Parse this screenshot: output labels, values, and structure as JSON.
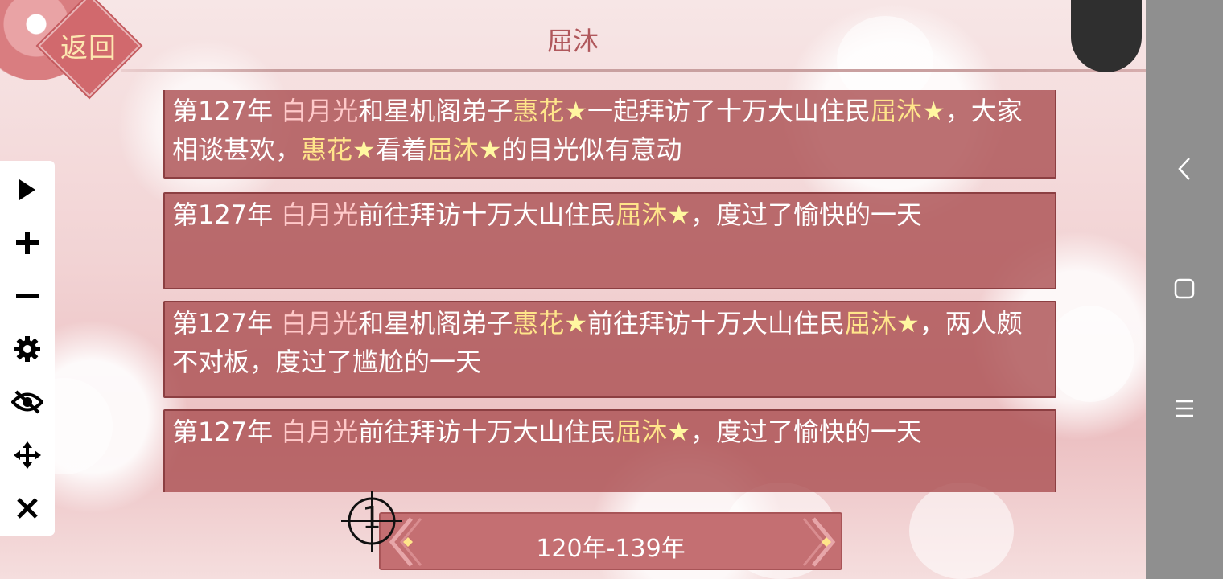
{
  "header": {
    "back_label": "返回",
    "title": "屈沐"
  },
  "toolbar": {
    "items": [
      {
        "name": "play-icon"
      },
      {
        "name": "plus-icon"
      },
      {
        "name": "minus-icon"
      },
      {
        "name": "gear-icon"
      },
      {
        "name": "eye-off-icon"
      },
      {
        "name": "move-icon"
      },
      {
        "name": "close-icon"
      }
    ]
  },
  "log": {
    "entries": [
      {
        "year": "第127年 ",
        "segments": [
          {
            "text": "白月光",
            "style": "a"
          },
          {
            "text": "和星机阁弟子",
            "style": "n"
          },
          {
            "text": "惠花",
            "style": "b"
          },
          {
            "text": "★",
            "style": "s"
          },
          {
            "text": "一起拜访了十万大山住民",
            "style": "n"
          },
          {
            "text": "屈沐",
            "style": "b"
          },
          {
            "text": "★",
            "style": "s"
          },
          {
            "text": "，大家相谈甚欢，",
            "style": "n"
          },
          {
            "text": "惠花",
            "style": "b"
          },
          {
            "text": "★",
            "style": "s"
          },
          {
            "text": "看着",
            "style": "n"
          },
          {
            "text": "屈沐",
            "style": "b"
          },
          {
            "text": "★",
            "style": "s"
          },
          {
            "text": "的目光似有意动",
            "style": "n"
          }
        ]
      },
      {
        "year": "第127年 ",
        "segments": [
          {
            "text": "白月光",
            "style": "a"
          },
          {
            "text": "前往拜访十万大山住民",
            "style": "n"
          },
          {
            "text": "屈沐",
            "style": "b"
          },
          {
            "text": "★",
            "style": "s"
          },
          {
            "text": "，度过了愉快的一天",
            "style": "n"
          }
        ]
      },
      {
        "year": "第127年 ",
        "segments": [
          {
            "text": "白月光",
            "style": "a"
          },
          {
            "text": "和星机阁弟子",
            "style": "n"
          },
          {
            "text": "惠花",
            "style": "b"
          },
          {
            "text": "★",
            "style": "s"
          },
          {
            "text": "前往拜访十万大山住民",
            "style": "n"
          },
          {
            "text": "屈沐",
            "style": "b"
          },
          {
            "text": "★",
            "style": "s"
          },
          {
            "text": "，两人颇不对板，度过了尴尬的一天",
            "style": "n"
          }
        ]
      },
      {
        "year": "第127年 ",
        "segments": [
          {
            "text": "白月光",
            "style": "a"
          },
          {
            "text": "前往拜访十万大山住民",
            "style": "n"
          },
          {
            "text": "屈沐",
            "style": "b"
          },
          {
            "text": "★",
            "style": "s"
          },
          {
            "text": "，度过了愉快的一天",
            "style": "n"
          }
        ]
      }
    ]
  },
  "pager": {
    "label": "120年-139年",
    "marker": "1"
  },
  "system_nav": {
    "buttons": [
      {
        "name": "back-nav-icon"
      },
      {
        "name": "home-nav-icon"
      },
      {
        "name": "menu-nav-icon"
      }
    ]
  },
  "colors": {
    "entry_bg": "#ac5254",
    "highlight_name": "#ffc9c9",
    "highlight_person": "#ffe58a",
    "title": "#b0585c",
    "back_text": "#fde7b0"
  }
}
